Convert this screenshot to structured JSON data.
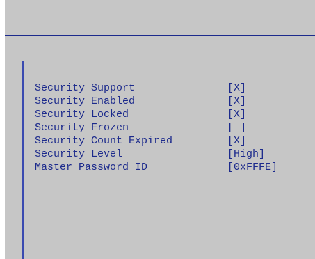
{
  "colors": {
    "background": "#c6c6c6",
    "text": "#1c2a8c",
    "accent_line": "#1c2a8c"
  },
  "security": {
    "rows": [
      {
        "label": "Security Support",
        "value": "[X]"
      },
      {
        "label": "Security Enabled",
        "value": "[X]"
      },
      {
        "label": "Security Locked",
        "value": "[X]"
      },
      {
        "label": "Security Frozen",
        "value": "[ ]"
      },
      {
        "label": "Security Count Expired",
        "value": "[X]"
      },
      {
        "label": "Security Level",
        "value": "[High]"
      },
      {
        "label": "Master Password ID",
        "value": "[0xFFFE]"
      }
    ]
  }
}
